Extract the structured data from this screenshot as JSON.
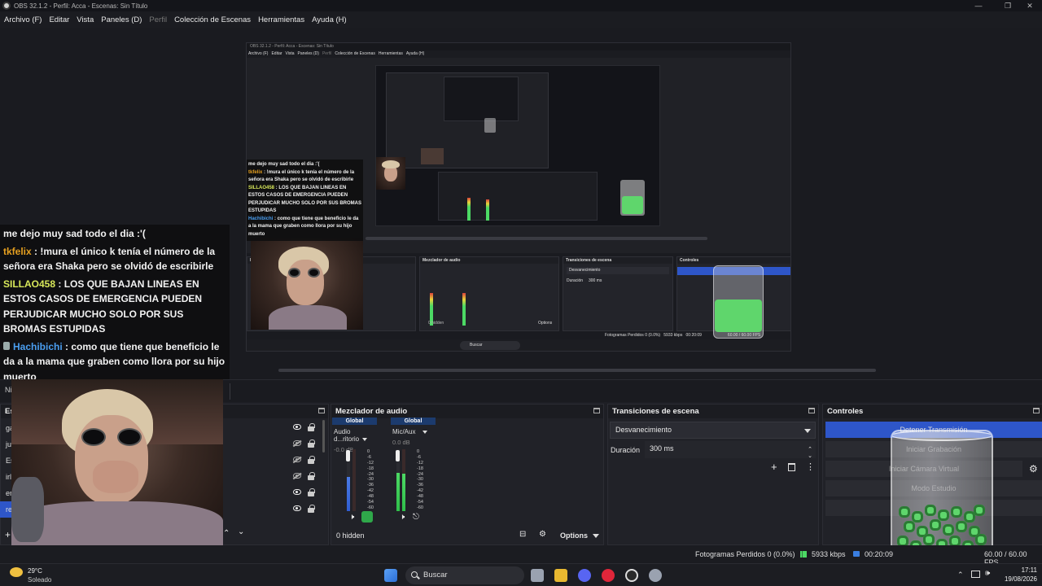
{
  "titlebar": {
    "title": "OBS 32.1.2 - Perfil: Acca - Escenas: Sin Título"
  },
  "menu": [
    {
      "label": "Archivo (F)",
      "enabled": true
    },
    {
      "label": "Editar",
      "enabled": true
    },
    {
      "label": "Vista",
      "enabled": true
    },
    {
      "label": "Paneles (D)",
      "enabled": true
    },
    {
      "label": "Perfil",
      "enabled": false
    },
    {
      "label": "Colección de Escenas",
      "enabled": true
    },
    {
      "label": "Herramientas",
      "enabled": true
    },
    {
      "label": "Ayuda (H)",
      "enabled": true
    }
  ],
  "chat": {
    "messages": [
      {
        "user": "",
        "text": "me dejo muy sad todo el dia :'("
      },
      {
        "user": "tkfelix",
        "text": " : !mura el único k tenía el número de la señora era Shaka pero se olvidó de escribirle"
      },
      {
        "user": "SILLAO458",
        "text": " : LOS QUE BAJAN LINEAS EN ESTOS CASOS DE EMERGENCIA PUEDEN PERJUDICAR MUCHO SOLO POR SUS BROMAS ESTUPIDAS"
      },
      {
        "user": "Hachibichi",
        "text": " : como que tiene que beneficio le da a la mama que graben como llora por su hijo muerto"
      }
    ]
  },
  "dock_strip": {
    "label": "Ni"
  },
  "sources": {
    "title": "Es",
    "items": [
      {
        "label": "ga",
        "visible": true
      },
      {
        "label": "ju",
        "visible": false
      },
      {
        "label": "Es",
        "visible": false
      },
      {
        "label": "irl",
        "visible": false
      },
      {
        "label": "er",
        "visible": true
      },
      {
        "label": "re",
        "visible": true
      }
    ]
  },
  "mixer": {
    "title": "Mezclador de audio",
    "channels": [
      {
        "group": "Global",
        "name": "Audio d...ritorio",
        "db": "-0.0 dB",
        "level": 0.55
      },
      {
        "group": "Global",
        "name": "Mic/Aux",
        "db": "0.0 dB",
        "level": 0.62
      }
    ],
    "scale": [
      "0",
      "-6",
      "-12",
      "-18",
      "-24",
      "-30",
      "-36",
      "-42",
      "-48",
      "-54",
      "-60"
    ],
    "hidden_label": "0 hidden",
    "options_label": "Options"
  },
  "transitions": {
    "title": "Transiciones de escena",
    "selected": "Desvanecimiento",
    "duration_label": "Duración",
    "duration_value": "300 ms"
  },
  "controls": {
    "title": "Controles",
    "buttons": [
      "Detener Transmisión",
      "Iniciar Grabación",
      "Iniciar Cámara Virtual",
      "Modo Estudio",
      ""
    ]
  },
  "status": {
    "dropped": "Fotogramas Perdidos 0 (0.0%)",
    "bitrate": "5933 kbps",
    "stream_time": "00:20:09",
    "fps": "60.00 / 60.00 FPS"
  },
  "taskbar": {
    "weather_temp": "29°C",
    "weather_desc": "Soleado",
    "search": "Buscar",
    "time": "17:11",
    "date": "19/08/2026"
  },
  "colors": {
    "accent": "#2e56c9",
    "bg": "#1e1f25",
    "meter_green": "#4cd964"
  }
}
